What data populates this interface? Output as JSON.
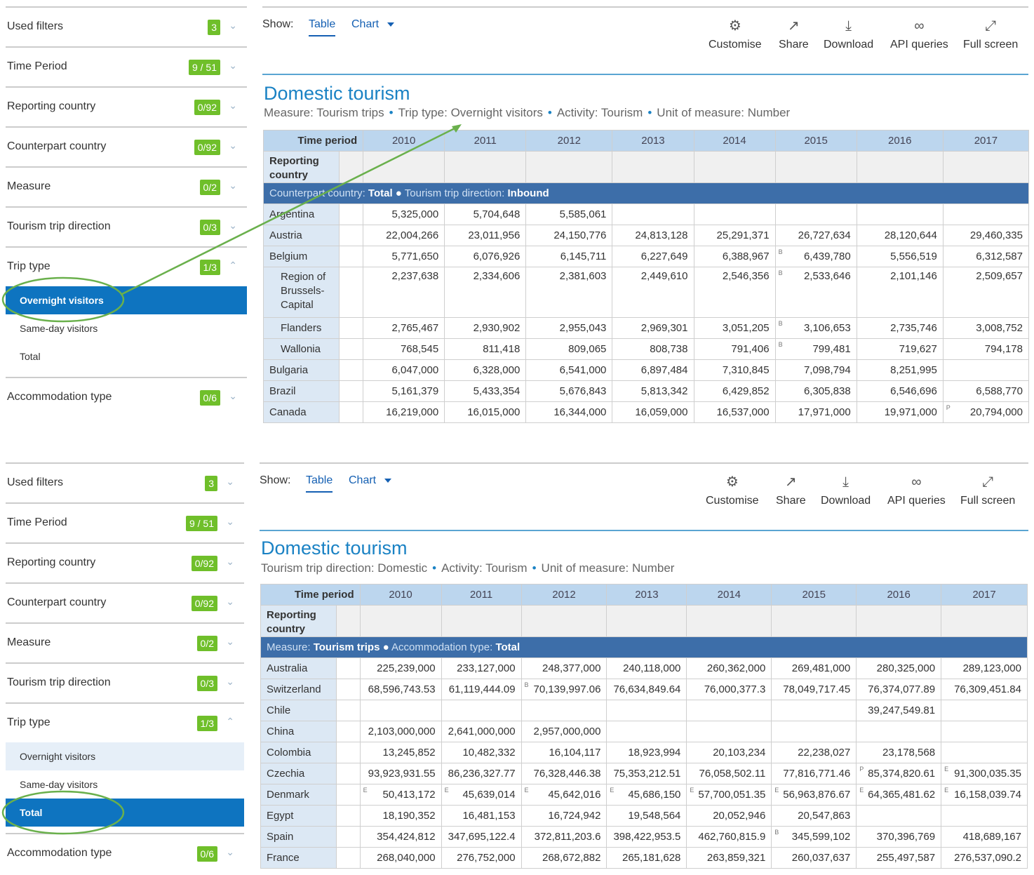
{
  "sidebar": {
    "filters": [
      {
        "label": "Used filters",
        "badge": "3"
      },
      {
        "label": "Time Period",
        "badge": "9 / 51"
      },
      {
        "label": "Reporting country",
        "badge": "0/92"
      },
      {
        "label": "Counterpart country",
        "badge": "0/92"
      },
      {
        "label": "Measure",
        "badge": "0/2"
      },
      {
        "label": "Tourism trip direction",
        "badge": "0/3"
      },
      {
        "label": "Trip type",
        "badge": "1/3"
      }
    ],
    "trip_type_options": [
      "Overnight visitors",
      "Same-day visitors",
      "Total"
    ],
    "accommodation": {
      "label": "Accommodation type",
      "badge": "0/6"
    }
  },
  "toolbar": {
    "show_label": "Show:",
    "tab_table": "Table",
    "tab_chart": "Chart",
    "tools": [
      {
        "label": "Customise",
        "icon": "gear-icon"
      },
      {
        "label": "Share",
        "icon": "share-icon"
      },
      {
        "label": "Download",
        "icon": "download-icon"
      },
      {
        "label": "API queries",
        "icon": "link-icon"
      },
      {
        "label": "Full screen",
        "icon": "fullscreen-icon"
      }
    ]
  },
  "years": [
    "2010",
    "2011",
    "2012",
    "2013",
    "2014",
    "2015",
    "2016",
    "2017"
  ],
  "time_period_label": "Time period",
  "reporting_country_label": "Reporting country",
  "panel1": {
    "title": "Domestic tourism",
    "subtitle": [
      {
        "key": "Measure",
        "val": "Tourism trips"
      },
      {
        "key": "Trip type",
        "val": "Overnight visitors"
      },
      {
        "key": "Activity",
        "val": "Tourism"
      },
      {
        "key": "Unit of measure",
        "val": "Number"
      }
    ],
    "band": [
      {
        "key": "Counterpart country",
        "val": "Total"
      },
      {
        "key": "Tourism trip direction",
        "val": "Inbound"
      }
    ],
    "rows": [
      {
        "name": "Argentina",
        "vals": [
          "5,325,000",
          "5,704,648",
          "5,585,061",
          "",
          "",
          "",
          "",
          ""
        ],
        "flags": [
          "",
          "",
          "",
          "",
          "",
          "",
          "",
          ""
        ]
      },
      {
        "name": "Austria",
        "vals": [
          "22,004,266",
          "23,011,956",
          "24,150,776",
          "24,813,128",
          "25,291,371",
          "26,727,634",
          "28,120,644",
          "29,460,335"
        ],
        "flags": [
          "",
          "",
          "",
          "",
          "",
          "",
          "",
          ""
        ]
      },
      {
        "name": "Belgium",
        "vals": [
          "5,771,650",
          "6,076,926",
          "6,145,711",
          "6,227,649",
          "6,388,967",
          "6,439,780",
          "5,556,519",
          "6,312,587"
        ],
        "flags": [
          "",
          "",
          "",
          "",
          "",
          "B",
          "",
          ""
        ]
      },
      {
        "name": "Region of Brussels-Capital",
        "vals": [
          "2,237,638",
          "2,334,606",
          "2,381,603",
          "2,449,610",
          "2,546,356",
          "2,533,646",
          "2,101,146",
          "2,509,657"
        ],
        "flags": [
          "",
          "",
          "",
          "",
          "",
          "B",
          "",
          ""
        ],
        "indent": true,
        "tall": true
      },
      {
        "name": "Flanders",
        "vals": [
          "2,765,467",
          "2,930,902",
          "2,955,043",
          "2,969,301",
          "3,051,205",
          "3,106,653",
          "2,735,746",
          "3,008,752"
        ],
        "flags": [
          "",
          "",
          "",
          "",
          "",
          "B",
          "",
          ""
        ],
        "indent": true
      },
      {
        "name": "Wallonia",
        "vals": [
          "768,545",
          "811,418",
          "809,065",
          "808,738",
          "791,406",
          "799,481",
          "719,627",
          "794,178"
        ],
        "flags": [
          "",
          "",
          "",
          "",
          "",
          "B",
          "",
          ""
        ],
        "indent": true
      },
      {
        "name": "Bulgaria",
        "vals": [
          "6,047,000",
          "6,328,000",
          "6,541,000",
          "6,897,484",
          "7,310,845",
          "7,098,794",
          "8,251,995",
          ""
        ],
        "flags": [
          "",
          "",
          "",
          "",
          "",
          "",
          "",
          ""
        ]
      },
      {
        "name": "Brazil",
        "vals": [
          "5,161,379",
          "5,433,354",
          "5,676,843",
          "5,813,342",
          "6,429,852",
          "6,305,838",
          "6,546,696",
          "6,588,770"
        ],
        "flags": [
          "",
          "",
          "",
          "",
          "",
          "",
          "",
          ""
        ]
      },
      {
        "name": "Canada",
        "vals": [
          "16,219,000",
          "16,015,000",
          "16,344,000",
          "16,059,000",
          "16,537,000",
          "17,971,000",
          "19,971,000",
          "20,794,000"
        ],
        "flags": [
          "",
          "",
          "",
          "",
          "",
          "",
          "",
          "P"
        ]
      }
    ]
  },
  "panel2": {
    "title": "Domestic tourism",
    "subtitle": [
      {
        "key": "Tourism trip direction",
        "val": "Domestic"
      },
      {
        "key": "Activity",
        "val": "Tourism"
      },
      {
        "key": "Unit of measure",
        "val": "Number"
      }
    ],
    "band": [
      {
        "key": "Measure",
        "val": "Tourism trips"
      },
      {
        "key": "Accommodation type",
        "val": "Total"
      }
    ],
    "rows": [
      {
        "name": "Australia",
        "vals": [
          "225,239,000",
          "233,127,000",
          "248,377,000",
          "240,118,000",
          "260,362,000",
          "269,481,000",
          "280,325,000",
          "289,123,000"
        ],
        "flags": [
          "",
          "",
          "",
          "",
          "",
          "",
          "",
          ""
        ]
      },
      {
        "name": "Switzerland",
        "vals": [
          "68,596,743.53",
          "61,119,444.09",
          "70,139,997.06",
          "76,634,849.64",
          "76,000,377.3",
          "78,049,717.45",
          "76,374,077.89",
          "76,309,451.84"
        ],
        "flags": [
          "",
          "",
          "B",
          "",
          "",
          "",
          "",
          ""
        ]
      },
      {
        "name": "Chile",
        "vals": [
          "",
          "",
          "",
          "",
          "",
          "",
          "39,247,549.81",
          ""
        ],
        "flags": [
          "",
          "",
          "",
          "",
          "",
          "",
          "",
          ""
        ]
      },
      {
        "name": "China",
        "vals": [
          "2,103,000,000",
          "2,641,000,000",
          "2,957,000,000",
          "",
          "",
          "",
          "",
          ""
        ],
        "flags": [
          "",
          "",
          "",
          "",
          "",
          "",
          "",
          ""
        ]
      },
      {
        "name": "Colombia",
        "vals": [
          "13,245,852",
          "10,482,332",
          "16,104,117",
          "18,923,994",
          "20,103,234",
          "22,238,027",
          "23,178,568",
          ""
        ],
        "flags": [
          "",
          "",
          "",
          "",
          "",
          "",
          "",
          ""
        ]
      },
      {
        "name": "Czechia",
        "vals": [
          "93,923,931.55",
          "86,236,327.77",
          "76,328,446.38",
          "75,353,212.51",
          "76,058,502.11",
          "77,816,771.46",
          "85,374,820.61",
          "91,300,035.35"
        ],
        "flags": [
          "",
          "",
          "",
          "",
          "",
          "",
          "P",
          "E"
        ]
      },
      {
        "name": "Denmark",
        "vals": [
          "50,413,172",
          "45,639,014",
          "45,642,016",
          "45,686,150",
          "57,700,051.35",
          "56,963,876.67",
          "64,365,481.62",
          "16,158,039.74"
        ],
        "flags": [
          "E",
          "E",
          "E",
          "E",
          "E",
          "E",
          "E",
          "E"
        ]
      },
      {
        "name": "Egypt",
        "vals": [
          "18,190,352",
          "16,481,153",
          "16,724,942",
          "19,548,564",
          "20,052,946",
          "20,547,863",
          "",
          ""
        ],
        "flags": [
          "",
          "",
          "",
          "",
          "",
          "",
          "",
          ""
        ]
      },
      {
        "name": "Spain",
        "vals": [
          "354,424,812",
          "347,695,122.4",
          "372,811,203.6",
          "398,422,953.5",
          "462,760,815.9",
          "345,599,102",
          "370,396,769",
          "418,689,167"
        ],
        "flags": [
          "",
          "",
          "",
          "",
          "",
          "B",
          "",
          ""
        ]
      },
      {
        "name": "France",
        "vals": [
          "268,040,000",
          "276,752,000",
          "268,672,882",
          "265,181,628",
          "263,859,321",
          "260,037,637",
          "255,497,587",
          "276,537,090.2"
        ],
        "flags": [
          "",
          "",
          "",
          "",
          "",
          "",
          "",
          ""
        ]
      }
    ]
  },
  "colors": {
    "accent": "#1a82c4",
    "badge": "#6fbf2a",
    "selected": "#0e74c0",
    "band": "#3d6ea9",
    "annotation": "#6ab04c"
  }
}
